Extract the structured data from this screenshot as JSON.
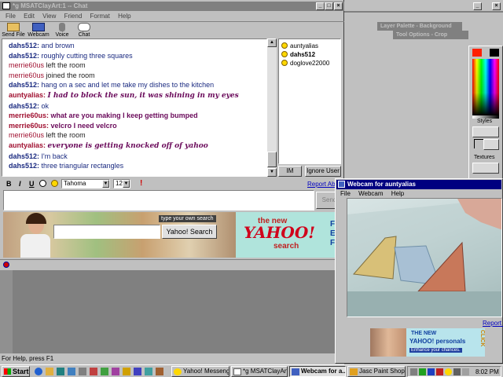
{
  "chat_window": {
    "title": "*g MSATClayArt:1 -- Chat",
    "menu": [
      "File",
      "Edit",
      "View",
      "Friend",
      "Format",
      "Help"
    ],
    "toolbar": [
      "Send File",
      "Webcam",
      "Voice",
      "Chat"
    ],
    "messages": [
      {
        "nick": "dahs512:",
        "text": "and brown",
        "style": "blue"
      },
      {
        "nick": "dahs512:",
        "text": "roughly cutting three squares",
        "style": "blue"
      },
      {
        "nick": "merrie60us",
        "text": "left the room",
        "style": "sys"
      },
      {
        "nick": "merrie60us",
        "text": "joined the room",
        "style": "sys"
      },
      {
        "nick": "dahs512:",
        "text": "hang on a sec and let me take my dishes to the kitchen",
        "style": "blue"
      },
      {
        "nick": "auntyalias:",
        "text": "I had to block the sun, it was shining in my eyes",
        "style": "script"
      },
      {
        "nick": "dahs512:",
        "text": "ok",
        "style": "blue"
      },
      {
        "nick": "merrie60us:",
        "text": "what are you making I keep getting bumped",
        "style": "bold"
      },
      {
        "nick": "merrie60us:",
        "text": "velcro I need velcro",
        "style": "bold"
      },
      {
        "nick": "merrie60us",
        "text": "left the room",
        "style": "sys"
      },
      {
        "nick": "auntyalias:",
        "text": "everyone is getting knocked off of yahoo",
        "style": "script"
      },
      {
        "nick": "dahs512:",
        "text": "I'm back",
        "style": "blue"
      },
      {
        "nick": "dahs512:",
        "text": "three triangular rectangles",
        "style": "blue"
      }
    ],
    "users": [
      "auntyalias",
      "dahs512",
      "doglove22000"
    ],
    "im_label": "IM",
    "ignore_label": "Ignore User",
    "format": {
      "bold": "B",
      "italic": "I",
      "underline": "U",
      "font": "Tahoma",
      "size": "12"
    },
    "report_link": "Report Abuse",
    "send_label": "Send",
    "status": "For Help, press F1"
  },
  "ad": {
    "search_label": "type your own search",
    "search_button": "Yahoo! Search",
    "the_new": "the new",
    "brand": "YAHOO!",
    "sub": "search"
  },
  "paint": {
    "palette_title": "Layer Palette - Background",
    "options_title": "Tool Options - Crop",
    "styles_label": "Styles",
    "textures_label": "Textures"
  },
  "webcam": {
    "title": "Webcam for auntyalias",
    "menu": [
      "File",
      "Webcam",
      "Help"
    ],
    "report_link": "Report Abuse",
    "ad_the_new": "THE NEW",
    "ad_brand": "YAHOO! personals",
    "ad_sub": "Enhance your chances.",
    "ad_click": "CLICK"
  },
  "taskbar": {
    "start": "Start",
    "tasks": [
      "Yahoo! Messenger",
      "*g MSATClayArt...",
      "Webcam for a...",
      "Jasc Paint Shop ..."
    ],
    "clock": "8:02 PM"
  },
  "colors": {
    "title_active": "#000080",
    "title_inactive": "#808080",
    "chat_blue": "#1a2a80",
    "chat_purple": "#6a0a5a",
    "yahoo_red": "#d0021b"
  }
}
